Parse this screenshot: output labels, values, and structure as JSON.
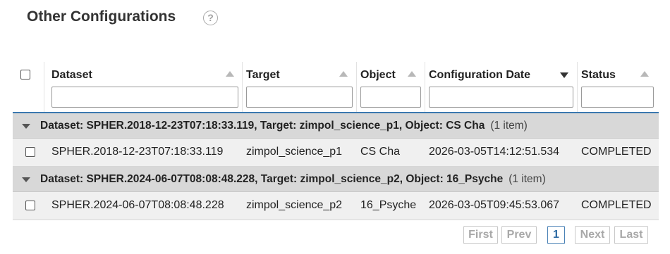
{
  "title": "Other Configurations",
  "help_icon": "question-circle-icon",
  "columns": [
    {
      "label": "Dataset",
      "sort": "up"
    },
    {
      "label": "Target",
      "sort": "up"
    },
    {
      "label": "Object",
      "sort": "up"
    },
    {
      "label": "Configuration Date",
      "sort": "down"
    },
    {
      "label": "Status",
      "sort": "up"
    }
  ],
  "filters": {
    "dataset": "",
    "target": "",
    "object": "",
    "configuration_date": "",
    "status": ""
  },
  "groups": [
    {
      "label": "Dataset: SPHER.2018-12-23T07:18:33.119, Target: zimpol_science_p1, Object: CS Cha",
      "count": "(1 item)",
      "row": {
        "dataset": "SPHER.2018-12-23T07:18:33.119",
        "target": "zimpol_science_p1",
        "object": "CS Cha",
        "configuration_date": "2026-03-05T14:12:51.534",
        "status": "COMPLETED"
      }
    },
    {
      "label": "Dataset: SPHER.2024-06-07T08:08:48.228, Target: zimpol_science_p2, Object: 16_Psyche",
      "count": "(1 item)",
      "row": {
        "dataset": "SPHER.2024-06-07T08:08:48.228",
        "target": "zimpol_science_p2",
        "object": "16_Psyche",
        "configuration_date": "2026-03-05T09:45:53.067",
        "status": "COMPLETED"
      }
    }
  ],
  "pager": {
    "first": "First",
    "prev": "Prev",
    "current": "1",
    "next": "Next",
    "last": "Last"
  },
  "colors": {
    "header_border": "#3b78b0",
    "group_bg": "#d8d8d8",
    "row_bg": "#f0f0f0",
    "active_page": "#2d6aa3"
  }
}
